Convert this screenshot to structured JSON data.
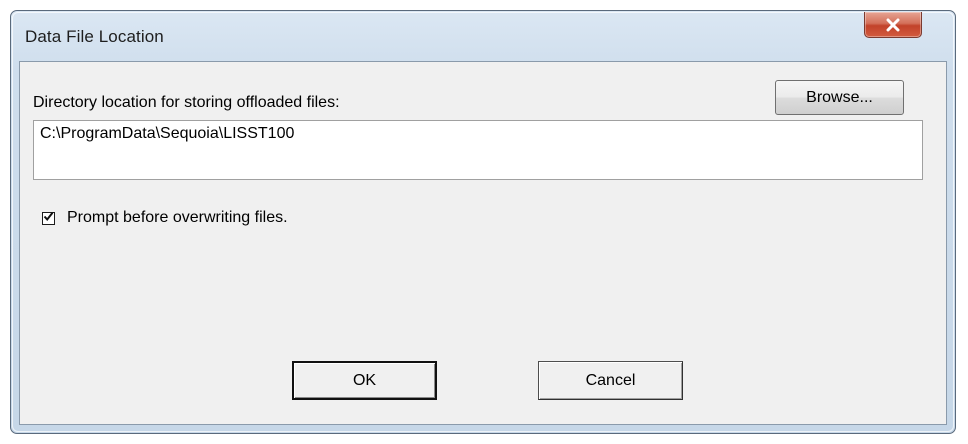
{
  "window": {
    "title": "Data File Location"
  },
  "icons": {
    "close": "close-icon",
    "checkbox": "checkmark-icon"
  },
  "directory": {
    "label": "Directory location for storing offloaded files:",
    "value": "C:\\ProgramData\\Sequoia\\LISST100",
    "browse_label": "Browse..."
  },
  "prompt": {
    "label": "Prompt before overwriting files.",
    "checked": true
  },
  "buttons": {
    "ok_label": "OK",
    "cancel_label": "Cancel"
  },
  "colors": {
    "close_button": "#c2422a",
    "title_bar": "#cfdeed",
    "client_background": "#f0f0f0"
  }
}
